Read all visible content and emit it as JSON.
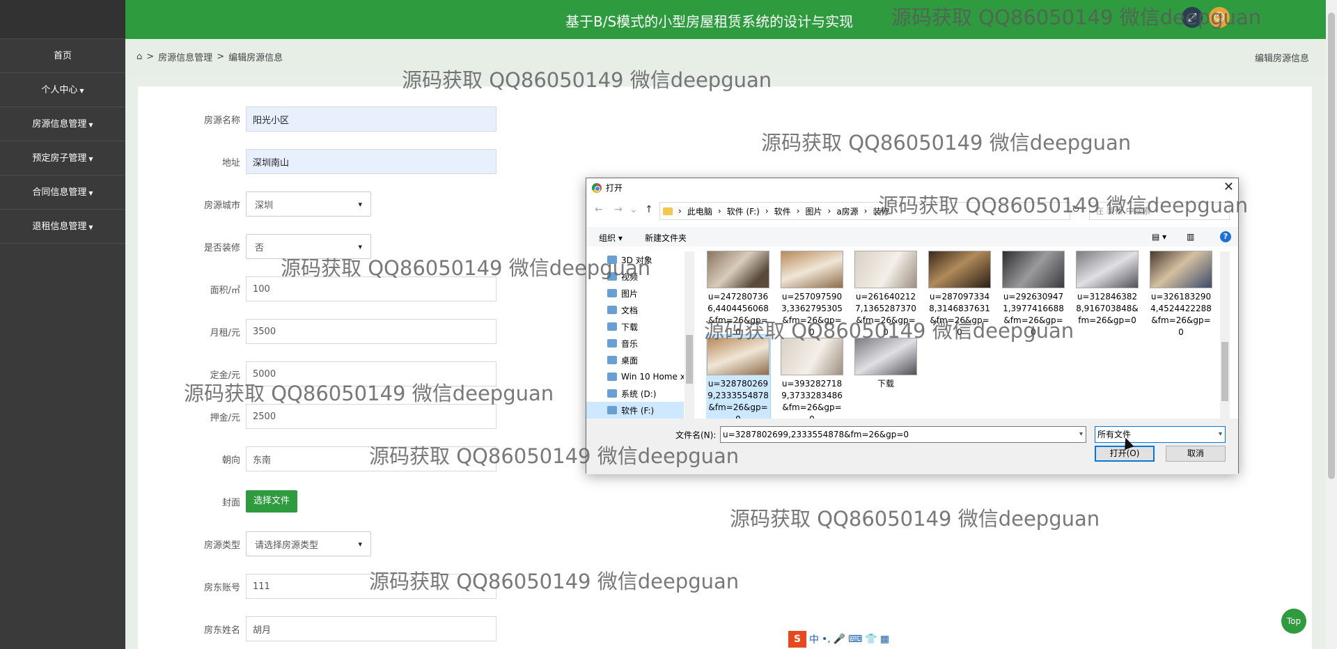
{
  "header": {
    "title": "基于B/S模式的小型房屋租赁系统的设计与实现",
    "watermark": "源码获取 QQ86050149 微信deepguan"
  },
  "sidebar": {
    "items": [
      {
        "label": "首页",
        "dropdown": false
      },
      {
        "label": "个人中心",
        "dropdown": true
      },
      {
        "label": "房源信息管理",
        "dropdown": true
      },
      {
        "label": "预定房子管理",
        "dropdown": true
      },
      {
        "label": "合同信息管理",
        "dropdown": true
      },
      {
        "label": "退租信息管理",
        "dropdown": true
      }
    ]
  },
  "breadcrumb": {
    "sep": ">",
    "level1": "房源信息管理",
    "level2": "编辑房源信息",
    "right": "编辑房源信息"
  },
  "form": {
    "name_label": "房源名称",
    "name_value": "阳光小区",
    "address_label": "地址",
    "address_value": "深圳南山",
    "city_label": "房源城市",
    "city_value": "深圳",
    "decor_label": "是否装修",
    "decor_value": "否",
    "area_label": "面积/㎡",
    "area_value": "100",
    "rent_label": "月租/元",
    "rent_value": "3500",
    "deposit_label": "定金/元",
    "deposit_value": "5000",
    "pledge_label": "押金/元",
    "pledge_value": "2500",
    "orient_label": "朝向",
    "orient_value": "东南",
    "cover_label": "封面",
    "cover_button": "选择文件",
    "type_label": "房源类型",
    "type_value": "请选择房源类型",
    "landlord_acc_label": "房东账号",
    "landlord_acc_value": "111",
    "landlord_name_label": "房东姓名",
    "landlord_name_value": "胡月"
  },
  "top_button": "Top",
  "ime": {
    "logo": "S",
    "mode": "中",
    "punct": "•,"
  },
  "dialog": {
    "title": "打开",
    "path": [
      "此电脑",
      "软件 (F:)",
      "软件",
      "图片",
      "a房源",
      "装修"
    ],
    "search_placeholder": "在 装修 中搜索",
    "organize": "组织",
    "new_folder": "新建文件夹",
    "tree": [
      {
        "label": "3D 对象",
        "selected": false
      },
      {
        "label": "视频",
        "selected": false
      },
      {
        "label": "图片",
        "selected": false
      },
      {
        "label": "文档",
        "selected": false
      },
      {
        "label": "下载",
        "selected": false
      },
      {
        "label": "音乐",
        "selected": false
      },
      {
        "label": "桌面",
        "selected": false
      },
      {
        "label": "Win 10 Home x",
        "selected": false
      },
      {
        "label": "系统 (D:)",
        "selected": false
      },
      {
        "label": "软件 (F:)",
        "selected": true
      }
    ],
    "files_row1": [
      {
        "name": "u=2472807366,4404456068&fm=26&gp=0"
      },
      {
        "name": "u=2570975903,3362795305&fm=26&gp=0"
      },
      {
        "name": "u=2616402127,1365287370&fm=26&gp=0"
      },
      {
        "name": "u=2870973348,3146837631&fm=26&gp=0"
      },
      {
        "name": "u=2926309471,3977416688&fm=26&gp=0"
      },
      {
        "name": "u=3128463828,916703848&fm=26&gp=0"
      },
      {
        "name": "u=3261832904,4524422288&fm=26&gp=0"
      }
    ],
    "files_row2": [
      {
        "name": "u=3287802699,2333554878&fm=26&gp=0",
        "selected": true
      },
      {
        "name": "u=3932827189,3733283486&fm=26&gp=0",
        "selected": false
      },
      {
        "name": "下载",
        "selected": false
      }
    ],
    "filename_label": "文件名(N):",
    "filename_value": "u=3287802699,2333554878&fm=26&gp=0",
    "filetype_value": "所有文件",
    "open_button": "打开(O)",
    "cancel_button": "取消"
  }
}
